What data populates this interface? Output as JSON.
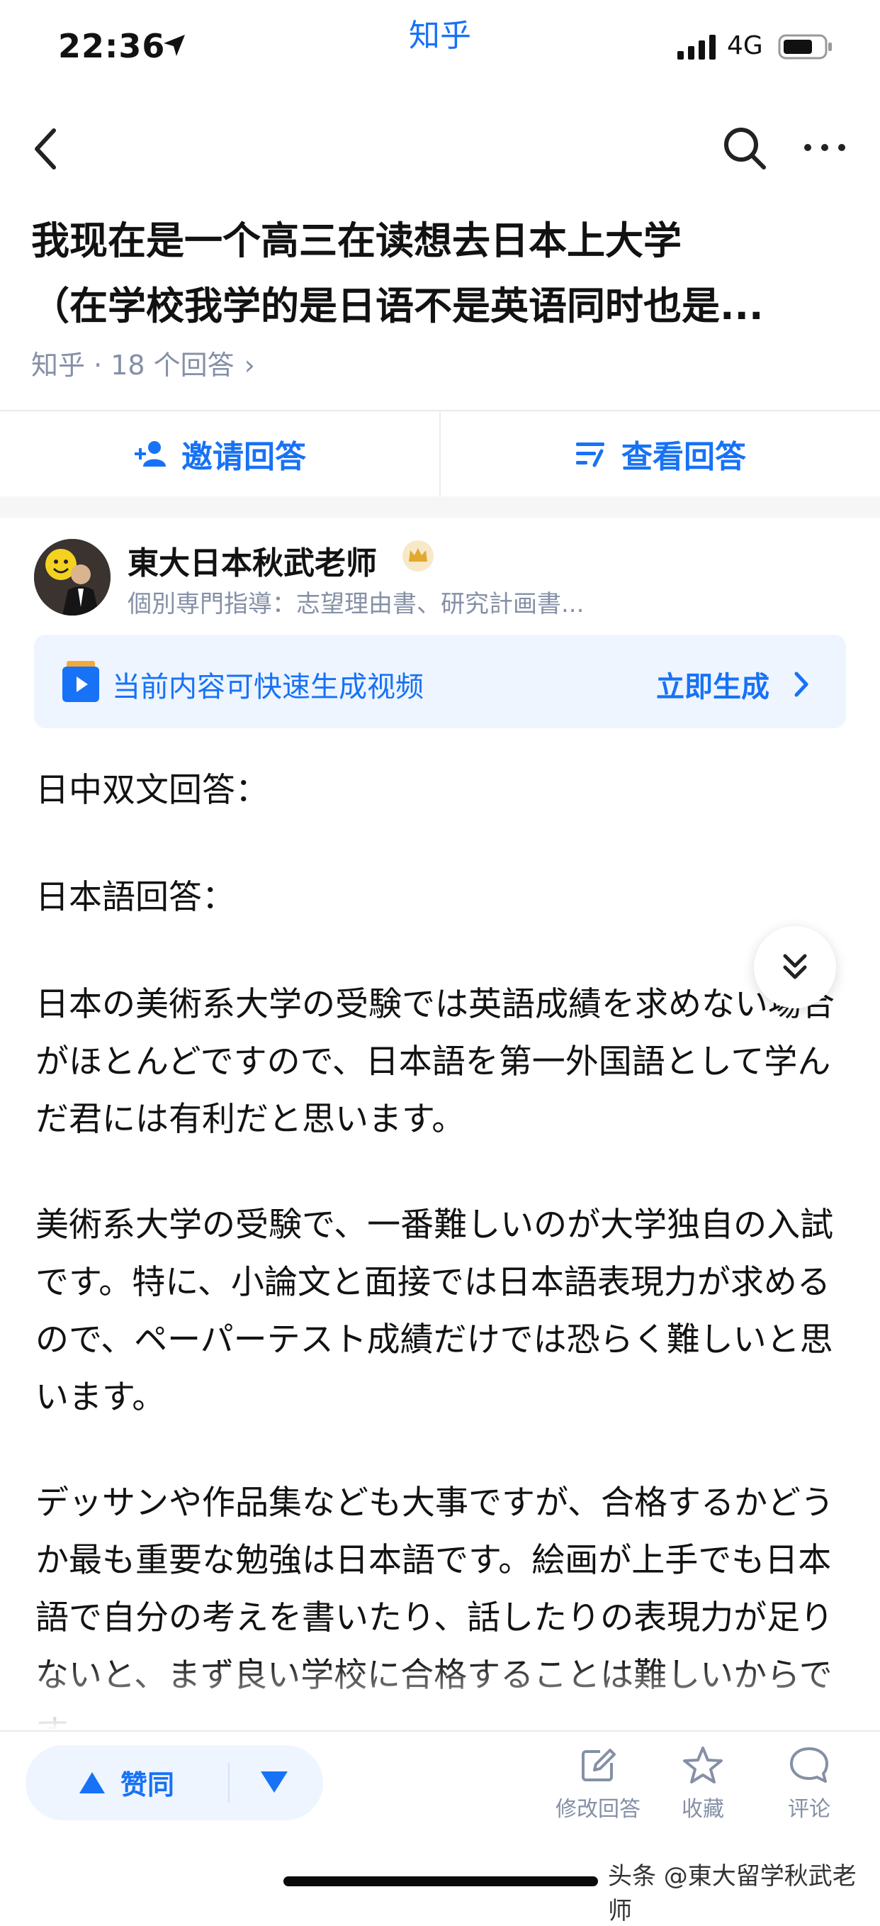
{
  "status_bar": {
    "time": "22:36",
    "app": "知乎",
    "network": "4G"
  },
  "nav": {
    "back_icon": "chevron-left-icon",
    "search_icon": "search-icon",
    "more_icon": "more-icon"
  },
  "question": {
    "title_line1": "我现在是一个高三在读想去日本上大学",
    "title_line2": "（在学校我学的是日语不是英语同时也是...",
    "meta": "知乎 · 18 个回答",
    "meta_chevron": "›"
  },
  "actions": {
    "invite_label": "邀请回答",
    "view_label": "查看回答"
  },
  "author": {
    "name": "東大日本秋武老师",
    "description": "個別専門指導：志望理由書、研究計画書..."
  },
  "banner": {
    "text": "当前内容可快速生成视频",
    "cta": "立即生成"
  },
  "answer": {
    "paragraphs": [
      "日中双文回答：",
      "日本語回答：",
      "日本の美術系大学の受験では英語成績を求めない場合がほとんどですので、日本語を第一外国語として学んだ君には有利だと思います。",
      "美術系大学の受験で、一番難しいのが大学独自の入試です。特に、小論文と面接では日本語表現力が求めるので、ペーパーテスト成績だけでは恐らく難しいと思います。",
      "デッサンや作品集なども大事ですが、合格するかどうか最も重要な勉強は日本語です。絵画が上手でも日本語で自分の考えを書いたり、話したりの表現力が足りないと、まず良い学校に合格することは難しいからです。"
    ]
  },
  "bottom_bar": {
    "upvote_label": "赞同",
    "edit_label": "修改回答",
    "favorite_label": "收藏",
    "comment_label": "评论"
  },
  "watermark": "头条 @東大留学秋武老师",
  "colors": {
    "accent": "#1772f6",
    "muted": "#8590a6",
    "banner_bg": "#eef5ff"
  }
}
